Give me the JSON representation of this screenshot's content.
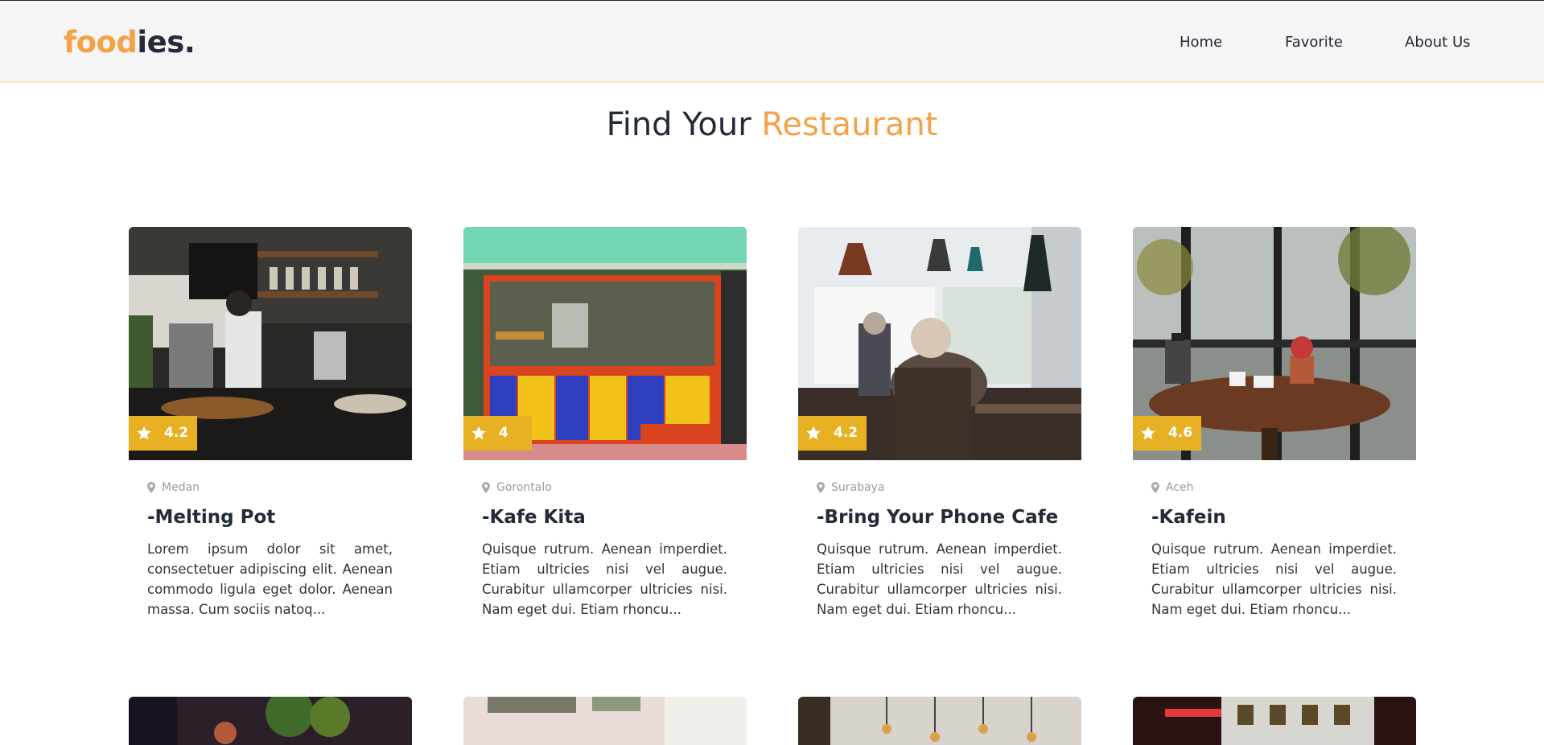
{
  "brand": {
    "logo_accent": "food",
    "logo_rest": "ies.",
    "accent_color": "#f4a24a"
  },
  "nav": {
    "home": "Home",
    "favorite": "Favorite",
    "about": "About Us"
  },
  "page": {
    "title_start": "Find Your ",
    "title_highlight": "Restaurant"
  },
  "restaurants": [
    {
      "rating": "4.2",
      "city": "Medan",
      "name": "-Melting Pot",
      "description": "Lorem ipsum dolor sit amet, consectetuer adipiscing elit. Aenean commodo ligula eget dolor. Aenean massa. Cum sociis natoq..."
    },
    {
      "rating": "4",
      "city": "Gorontalo",
      "name": "-Kafe Kita",
      "description": "Quisque rutrum. Aenean imperdiet. Etiam ultricies nisi vel augue. Curabitur ullamcorper ultricies nisi. Nam eget dui. Etiam rhoncu..."
    },
    {
      "rating": "4.2",
      "city": "Surabaya",
      "name": "-Bring Your Phone Cafe",
      "description": "Quisque rutrum. Aenean imperdiet. Etiam ultricies nisi vel augue. Curabitur ullamcorper ultricies nisi. Nam eget dui. Etiam rhoncu..."
    },
    {
      "rating": "4.6",
      "city": "Aceh",
      "name": "-Kafein",
      "description": "Quisque rutrum. Aenean imperdiet. Etiam ultricies nisi vel augue. Curabitur ullamcorper ultricies nisi. Nam eget dui. Etiam rhoncu..."
    }
  ],
  "icons": {
    "rating": "star-icon",
    "location": "map-pin-icon"
  }
}
